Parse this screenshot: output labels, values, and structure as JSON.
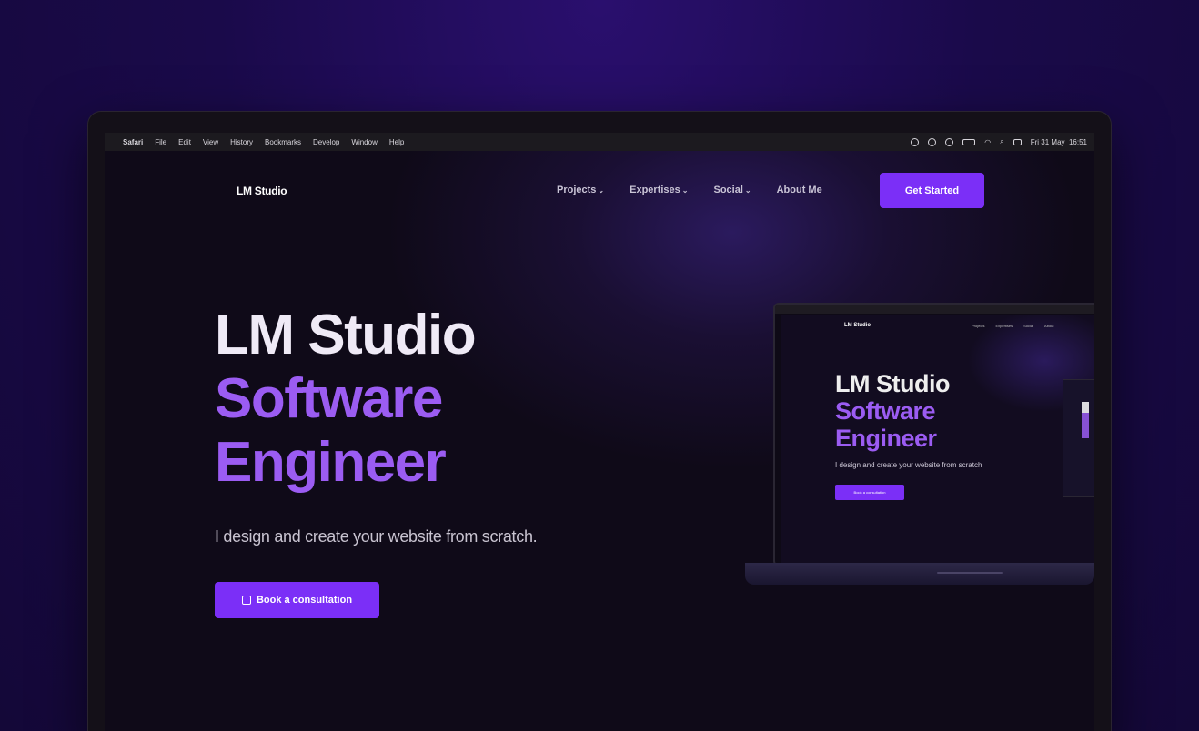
{
  "menubar": {
    "app": "Safari",
    "items": [
      "File",
      "Edit",
      "View",
      "History",
      "Bookmarks",
      "Develop",
      "Window",
      "Help"
    ],
    "clock": "Fri 31 May  16:51"
  },
  "nav": {
    "logo": "LM Studio",
    "links": [
      "Projects",
      "Expertises",
      "Social",
      "About Me"
    ],
    "cta": "Get Started"
  },
  "hero": {
    "line1": "LM Studio",
    "line2": "Software",
    "line3": "Engineer",
    "subtitle": "I design and create your website from scratch.",
    "button": "Book a consultation"
  },
  "preview": {
    "logo": "LM Studio",
    "links": [
      "Projects",
      "Expertises",
      "Social",
      "About"
    ],
    "line1": "LM Studio",
    "line2": "Software",
    "line3": "Engineer",
    "subtitle": "I design and create your website from scratch",
    "button": "Book a consultation"
  },
  "colors": {
    "accent": "#7b2ff7",
    "accent_text": "#9b5cf2",
    "background": "#0f0a18"
  }
}
